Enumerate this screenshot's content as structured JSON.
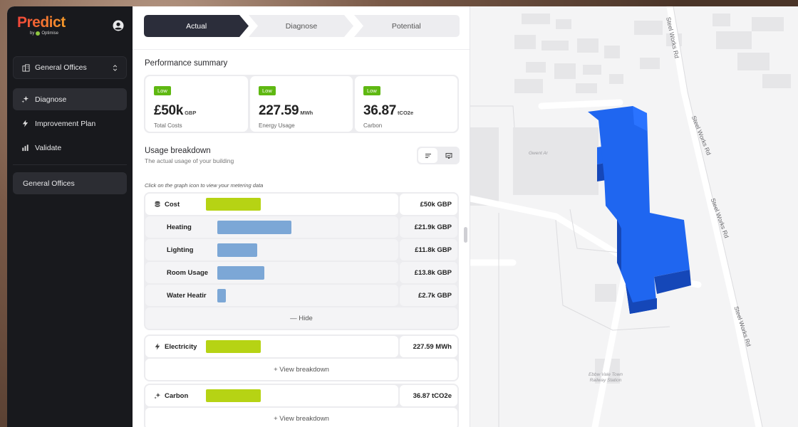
{
  "app": {
    "logo_text": "Predict",
    "logo_sub_prefix": "by",
    "logo_sub_brand": "Optimise"
  },
  "sidebar": {
    "building_select": "General Offices",
    "nav": [
      {
        "label": "Diagnose",
        "icon": "sparkle-icon",
        "active": true
      },
      {
        "label": "Improvement Plan",
        "icon": "lightning-icon",
        "active": false
      },
      {
        "label": "Validate",
        "icon": "bar-chart-icon",
        "active": false
      }
    ],
    "site_item": "General Offices"
  },
  "steps": [
    {
      "label": "Actual",
      "active": true
    },
    {
      "label": "Diagnose",
      "active": false
    },
    {
      "label": "Potential",
      "active": false
    }
  ],
  "performance": {
    "title": "Performance summary",
    "cards": [
      {
        "badge": "Low",
        "value": "£50k",
        "unit": "GBP",
        "caption": "Total Costs"
      },
      {
        "badge": "Low",
        "value": "227.59",
        "unit": "MWh",
        "caption": "Energy Usage"
      },
      {
        "badge": "Low",
        "value": "36.87",
        "unit": "tCO2e",
        "caption": "Carbon"
      }
    ]
  },
  "usage": {
    "title": "Usage breakdown",
    "subtitle": "The actual usage of your building",
    "hint": "Click on the graph icon to view your metering data",
    "cost": {
      "label": "Cost",
      "value": "£50k GBP",
      "bar_fraction": 1.0,
      "sub_rows": [
        {
          "label": "Heating",
          "value": "£21.9k GBP",
          "bar_fraction": 1.0
        },
        {
          "label": "Lighting",
          "value": "£11.8k GBP",
          "bar_fraction": 0.54
        },
        {
          "label": "Room Usage",
          "value": "£13.8k GBP",
          "bar_fraction": 0.63
        },
        {
          "label": "Water Heatir",
          "value": "£2.7k GBP",
          "bar_fraction": 0.12
        }
      ],
      "footer": "— Hide"
    },
    "electricity": {
      "label": "Electricity",
      "value": "227.59 MWh",
      "bar_fraction": 1.0,
      "footer": "+ View breakdown"
    },
    "carbon": {
      "label": "Carbon",
      "value": "36.87 tCO2e",
      "bar_fraction": 1.0,
      "footer": "+ View breakdown"
    }
  },
  "map": {
    "roads": [
      "Steel Works Rd",
      "Steel Works Rd",
      "Steel Works Rd",
      "Steel Works Rd"
    ],
    "poi_building": "Gwent Ar",
    "poi_station_line1": "Ebbw Vale Town",
    "poi_station_line2": "Railway Station",
    "building_color": "#1f66f0"
  },
  "colors": {
    "accent_dark": "#2b2d3a",
    "bar_green": "#b6d314",
    "bar_blue": "#7ca7d6",
    "badge_green": "#5fb812"
  }
}
